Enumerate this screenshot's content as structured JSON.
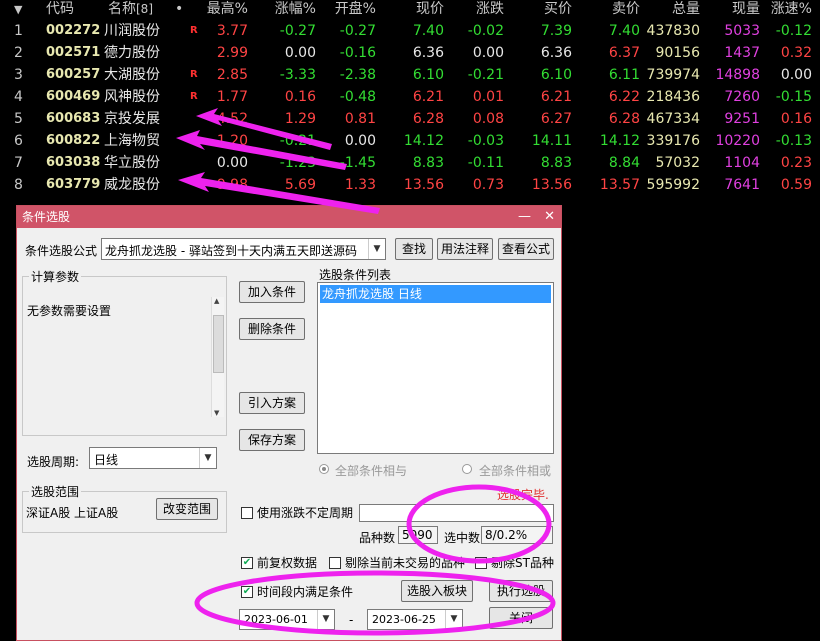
{
  "headers": {
    "code": "代码",
    "name": "名称",
    "count": "[8]",
    "dot": "•",
    "high": "最高%",
    "chg": "涨幅%",
    "open": "开盘%",
    "price": "现价",
    "diff": "涨跌",
    "bid": "买价",
    "ask": "卖价",
    "vol": "总量",
    "now": "现量",
    "speed": "涨速%"
  },
  "rows": [
    {
      "idx": "1",
      "code": "002272",
      "name": "川润股份",
      "mark": "R",
      "high": "3.77",
      "chg": "-0.27",
      "open": "-0.27",
      "price": "7.40",
      "diff": "-0.02",
      "bid": "7.39",
      "ask": "7.40",
      "vol": "437830",
      "now": "5033",
      "speed": "-0.12"
    },
    {
      "idx": "2",
      "code": "002571",
      "name": "德力股份",
      "mark": "",
      "high": "2.99",
      "chg": "0.00",
      "open": "-0.16",
      "price": "6.36",
      "diff": "0.00",
      "bid": "6.36",
      "ask": "6.37",
      "vol": "90156",
      "now": "1437",
      "speed": "0.32"
    },
    {
      "idx": "3",
      "code": "600257",
      "name": "大湖股份",
      "mark": "R",
      "high": "2.85",
      "chg": "-3.33",
      "open": "-2.38",
      "price": "6.10",
      "diff": "-0.21",
      "bid": "6.10",
      "ask": "6.11",
      "vol": "739974",
      "now": "14898",
      "speed": "0.00"
    },
    {
      "idx": "4",
      "code": "600469",
      "name": "风神股份",
      "mark": "R",
      "high": "1.77",
      "chg": "0.16",
      "open": "-0.48",
      "price": "6.21",
      "diff": "0.01",
      "bid": "6.21",
      "ask": "6.22",
      "vol": "218436",
      "now": "7260",
      "speed": "-0.15"
    },
    {
      "idx": "5",
      "code": "600683",
      "name": "京投发展",
      "mark": "",
      "high": "4.52",
      "chg": "1.29",
      "open": "0.81",
      "price": "6.28",
      "diff": "0.08",
      "bid": "6.27",
      "ask": "6.28",
      "vol": "467334",
      "now": "9251",
      "speed": "0.16"
    },
    {
      "idx": "6",
      "code": "600822",
      "name": "上海物贸",
      "mark": "",
      "high": "1.20",
      "chg": "-0.21",
      "open": "0.00",
      "price": "14.12",
      "diff": "-0.03",
      "bid": "14.11",
      "ask": "14.12",
      "vol": "339176",
      "now": "10220",
      "speed": "-0.13"
    },
    {
      "idx": "7",
      "code": "603038",
      "name": "华立股份",
      "mark": "",
      "high": "0.00",
      "chg": "-1.23",
      "open": "-1.45",
      "price": "8.83",
      "diff": "-0.11",
      "bid": "8.83",
      "ask": "8.84",
      "vol": "57032",
      "now": "1104",
      "speed": "0.23"
    },
    {
      "idx": "8",
      "code": "603779",
      "name": "威龙股份",
      "mark": "",
      "high": "9.98",
      "chg": "5.69",
      "open": "1.33",
      "price": "13.56",
      "diff": "0.73",
      "bid": "13.56",
      "ask": "13.57",
      "vol": "595992",
      "now": "7641",
      "speed": "0.59"
    }
  ],
  "dialog": {
    "title": "条件选股",
    "minimize": "—",
    "close": "✕",
    "formula_label": "条件选股公式",
    "formula_value": "龙舟抓龙选股 - 驿站签到十天内满五天即送源码",
    "find_btn": "查找",
    "usage_btn": "用法注释",
    "view_btn": "查看公式",
    "params_group": "计算参数",
    "params_text": "无参数需要设置",
    "add_btn": "加入条件",
    "del_btn": "删除条件",
    "import_btn": "引入方案",
    "save_btn": "保存方案",
    "list_label": "选股条件列表",
    "list_item": "龙舟抓龙选股  日线",
    "period_label": "选股周期:",
    "period_value": "日线",
    "radio_and": "全部条件相与",
    "radio_or": "全部条件相或",
    "done_text": "选股完毕.",
    "range_group": "选股范围",
    "range_text": "深证A股 上证A股",
    "change_range_btn": "改变范围",
    "var_period": "使用涨跌不定周期",
    "count_label": "品种数",
    "count_value": "5090",
    "selected_label": "选中数",
    "selected_value": "8/0.2%",
    "pre_adjust": "前复权数据",
    "exclude_new": "剔除当前未交易的品种",
    "exclude_st": "剔除ST品种",
    "time_cond": "时间段内满足条件",
    "add_block_btn": "选股入板块",
    "execute_btn": "执行选股",
    "date_from": "2023-06-01",
    "date_sep": "-",
    "date_to": "2023-06-25",
    "close_btn": "关闭"
  },
  "colors": {
    "annotation": "#ee22ee",
    "title_bar": "#d05468",
    "up": "#ff4444",
    "down": "#33dd33",
    "volume": "#e040e0"
  }
}
